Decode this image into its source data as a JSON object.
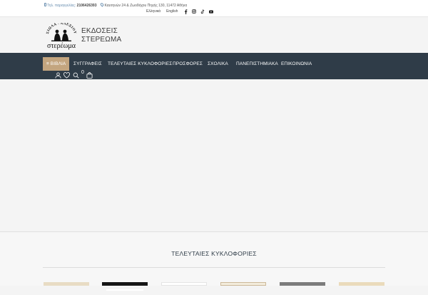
{
  "topbar": {
    "phone_label": "Τηλ. παραγγελίας:",
    "phone": "2106426393",
    "address": "Καυτηνών 24 & Ζωοδόχου Πηγής 130, 11472 Αθήνα",
    "lang_greek": "Ελληνικά",
    "lang_english": "English",
    "social_icons": [
      "facebook-icon",
      "instagram-icon",
      "tiktok-icon",
      "youtube-icon"
    ]
  },
  "brand": {
    "logo_top": "ΣΙΩΛΑ - ΑΛΕΞΙΟΥ",
    "logo_word": "στερέωμα",
    "line1": "ΕΚΔΟΣΕΙΣ",
    "line2": "ΣΤΕΡΕΩΜΑ"
  },
  "nav": {
    "items": [
      {
        "label": "≡ ΒΙΒΛΙΑ"
      },
      {
        "label": "ΣΥΓΓΡΑΦΕΙΣ"
      },
      {
        "label": "ΤΕΛΕΥΤΑΙΕΣ ΚΥΚΛΟΦΟΡΙΕΣ"
      },
      {
        "label": "ΠΡΟΣΦΟΡΕΣ"
      },
      {
        "label": "ΣΧΟΛΙΚΑ"
      },
      {
        "label": "ΠΑΝΕΠΙΣΤΗΜΙΑΚΑ"
      },
      {
        "label": "ΕΠΙΚΟΙΝΩΝΙΑ"
      }
    ],
    "cart_count": "0"
  },
  "latest": {
    "title": "ΤΕΛΕΥΤΑΙΕΣ ΚΥΚΛΟΦΟΡΙΕΣ"
  },
  "colors": {
    "nav_bg": "#2f3c48",
    "accent": "#c3a57f",
    "link": "#6a8fb0"
  }
}
